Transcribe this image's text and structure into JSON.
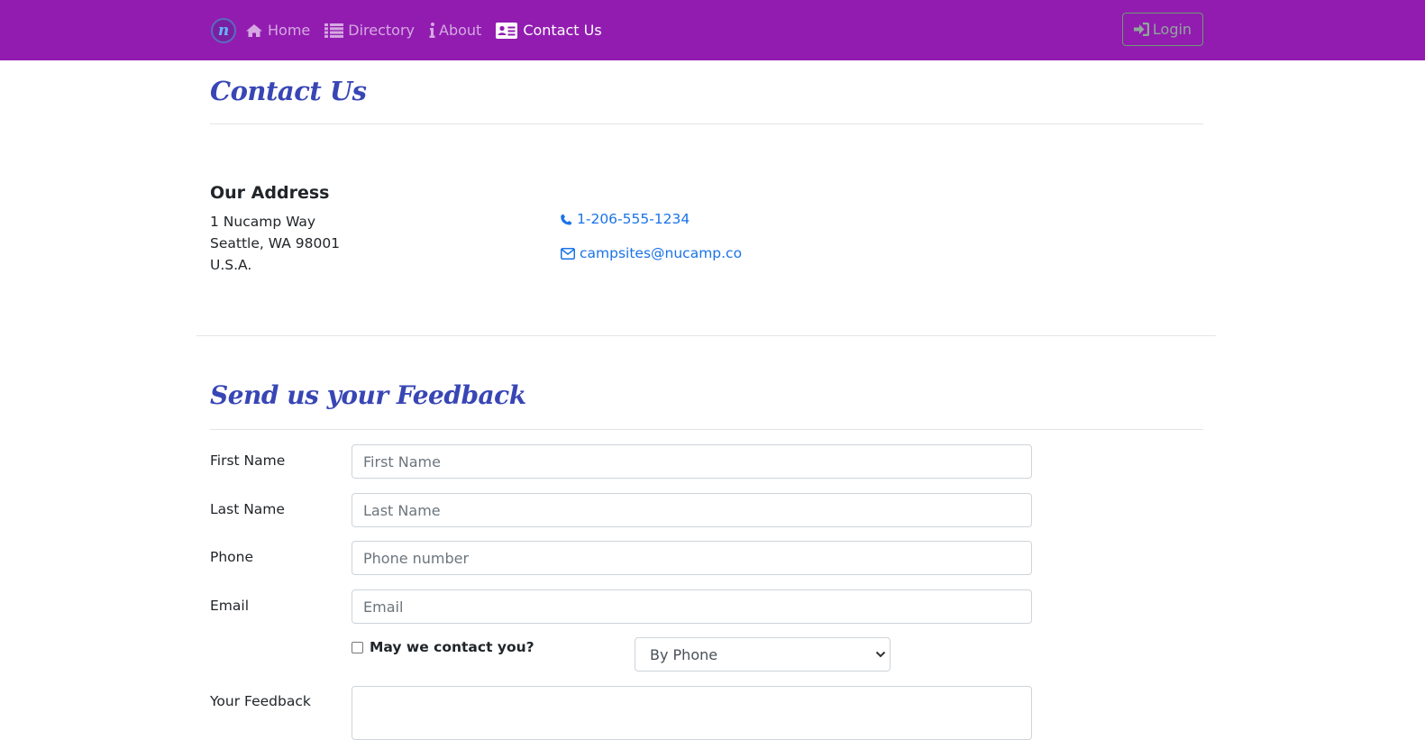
{
  "nav": {
    "brand_letter": "n",
    "items": [
      {
        "label": "Home",
        "icon": "home-icon"
      },
      {
        "label": "Directory",
        "icon": "list-icon"
      },
      {
        "label": "About",
        "icon": "info-icon"
      },
      {
        "label": "Contact Us",
        "icon": "address-card-icon",
        "active": true
      }
    ],
    "login_label": "Login"
  },
  "contact": {
    "title": "Contact Us",
    "address_heading": "Our Address",
    "address_lines": [
      "1 Nucamp Way",
      "Seattle, WA 98001",
      "U.S.A."
    ],
    "phone": "1-206-555-1234",
    "email": "campsites@nucamp.co"
  },
  "feedback": {
    "title": "Send us your Feedback",
    "fields": [
      {
        "label": "First Name",
        "placeholder": "First Name",
        "value": ""
      },
      {
        "label": "Last Name",
        "placeholder": "Last Name",
        "value": ""
      },
      {
        "label": "Phone",
        "placeholder": "Phone number",
        "value": ""
      },
      {
        "label": "Email",
        "placeholder": "Email",
        "value": ""
      }
    ],
    "contact_checkbox_label": "May we contact you?",
    "contact_checked": false,
    "contact_method_selected": "By Phone",
    "feedback_label": "Your Feedback"
  },
  "colors": {
    "navbar": "#921cb0",
    "heading": "#3846b5",
    "link": "#1a73e8"
  }
}
